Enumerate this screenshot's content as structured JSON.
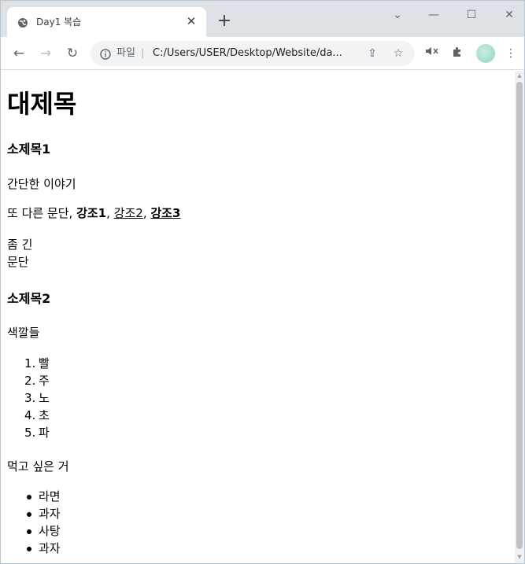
{
  "tab": {
    "title": "Day1 복습",
    "close": "✕"
  },
  "new_tab": "+",
  "window_controls": {
    "dropdown": "⌄",
    "minimize": "—",
    "maximize": "☐",
    "close": "✕"
  },
  "toolbar": {
    "back": "←",
    "forward": "→",
    "reload": "↻",
    "site_info_label": "파일",
    "separator": "|",
    "url": "C:/Users/USER/Desktop/Website/da...",
    "share": "⇪",
    "bookmark": "☆",
    "mute": "🔇",
    "extensions": "✱",
    "menu": "⋮"
  },
  "page": {
    "h1": "대제목",
    "h3_1": "소제목1",
    "p1": "간단한 이야기",
    "p2": {
      "prefix": "또 다른 문단, ",
      "strong1": "강조1",
      "sep1": ", ",
      "u2": "강조2",
      "sep2": ", ",
      "bu3": "강조3"
    },
    "p3_line1": "좀 긴",
    "p3_line2": "문단",
    "h3_2": "소제목2",
    "p4": "색깔들",
    "ordered_list": [
      "빨",
      "주",
      "노",
      "초",
      "파"
    ],
    "p5": "먹고 싶은 거",
    "unordered_list": [
      "라면",
      "과자",
      "사탕",
      "과자"
    ]
  },
  "scrollbar": {
    "up": "▲",
    "down": "▼"
  },
  "colors": {
    "tabstrip": "#dee1e6",
    "omnibox": "#f1f3f4",
    "icon": "#5f6368",
    "scroll_thumb": "#c1c1c1"
  }
}
